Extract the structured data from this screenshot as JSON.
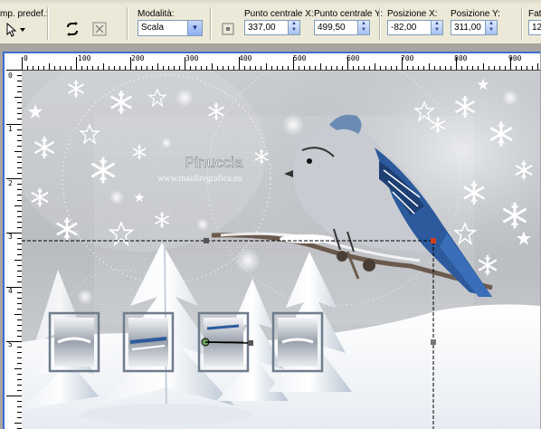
{
  "toolbar": {
    "preset_label": "mp. predef.:",
    "mode_label": "Modalità:",
    "mode_value": "Scala",
    "center_x_label": "Punto centrale X:",
    "center_x_value": "337,00",
    "center_y_label": "Punto centrale Y:",
    "center_y_value": "499,50",
    "pos_x_label": "Posizione X:",
    "pos_x_value": "-82,00",
    "pos_y_label": "Posizione Y:",
    "pos_y_value": "311,00",
    "scale_label": "Fatt",
    "scale_value": "12"
  },
  "ruler": {
    "top_ticks": [
      "0",
      "100",
      "200",
      "300",
      "400",
      "500",
      "600",
      "700",
      "800",
      "900"
    ],
    "left_ticks": [
      "0",
      "1",
      "2",
      "3",
      "4",
      "5"
    ]
  },
  "canvas": {
    "watermark_title": "Pinuccia",
    "watermark_url": "www.maidiregrafica.eu"
  },
  "colors": {
    "frame_blue": "#3a6fd0",
    "toolbar_bg": "#ece9d8",
    "bird_blue": "#2c5a9c"
  }
}
